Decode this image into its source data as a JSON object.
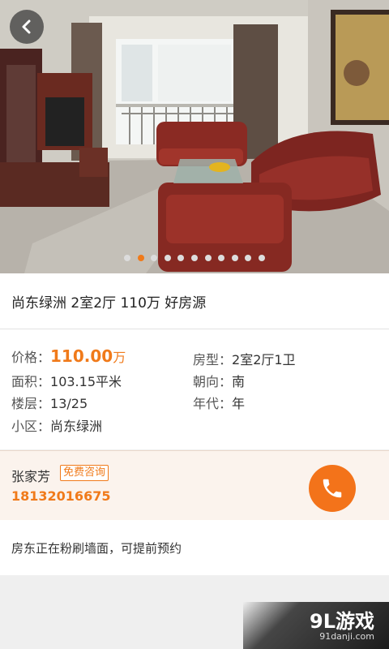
{
  "listing": {
    "title": "尚东绿洲 2室2厅 110万 好房源",
    "photo_count": 11,
    "photo_active_index": 1
  },
  "details": {
    "price_label": "价格：",
    "price_value": "110.00",
    "price_unit": "万",
    "layout_label": "房型：",
    "layout_value": "2室2厅1卫",
    "area_label": "面积：",
    "area_value": "103.15平米",
    "orientation_label": "朝向：",
    "orientation_value": "南",
    "floor_label": "楼层：",
    "floor_value": "13/25",
    "year_label": "年代：",
    "year_value": "年",
    "community_label": "小区：",
    "community_value": "尚东绿洲"
  },
  "agent": {
    "name": "张家芳",
    "badge": "免费咨询",
    "phone": "18132016675"
  },
  "description": "房东正在粉刷墙面，可提前预约",
  "watermark": {
    "text": "9L游戏",
    "url": "91danji.com"
  },
  "colors": {
    "accent": "#f07a1a",
    "call_button": "#f3731a"
  },
  "icons": [
    "back-arrow-icon",
    "phone-icon"
  ]
}
